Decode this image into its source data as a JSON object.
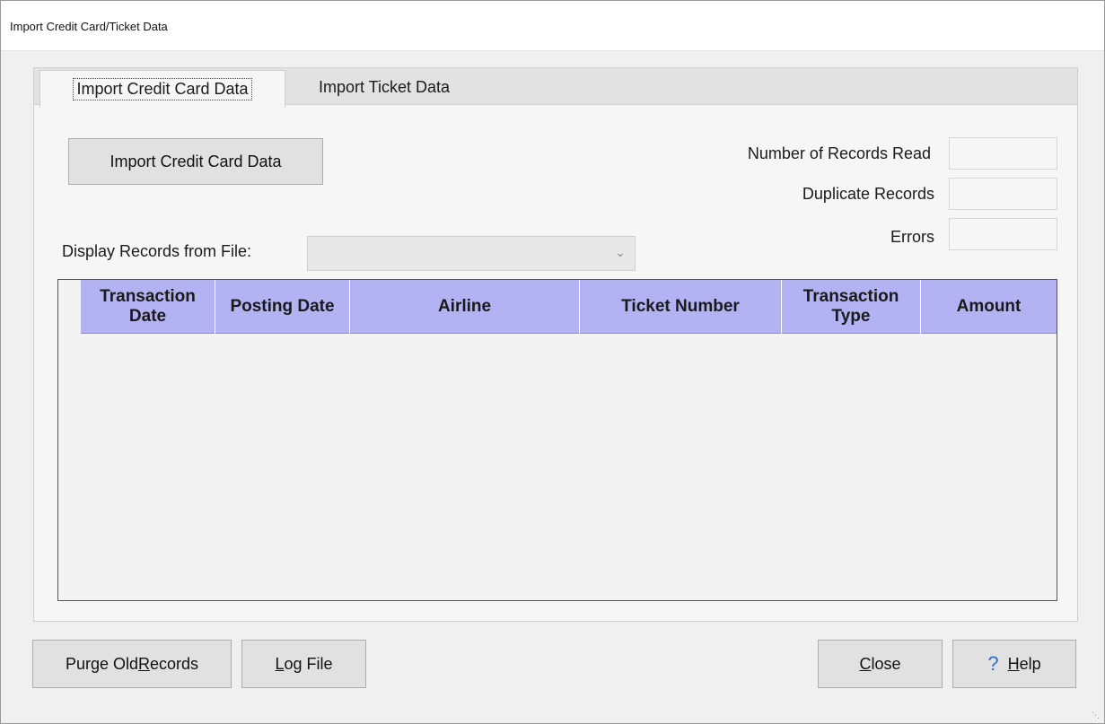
{
  "window": {
    "title": "Import Credit Card/Ticket Data"
  },
  "tabs": [
    {
      "label": "Import Credit Card Data",
      "active": true
    },
    {
      "label": "Import Ticket Data",
      "active": false
    }
  ],
  "panel": {
    "import_button": "Import Credit Card Data",
    "stats": {
      "records_read_label": "Number of Records Read",
      "records_read_value": "",
      "duplicates_label": "Duplicate Records",
      "duplicates_value": "",
      "errors_label": "Errors",
      "errors_value": ""
    },
    "display_label": "Display Records from File:",
    "display_select_value": "",
    "grid": {
      "columns": [
        "Transaction Date",
        "Posting Date",
        "Airline",
        "Ticket Number",
        "Transaction Type",
        "Amount"
      ],
      "rows": []
    }
  },
  "footer": {
    "purge_prefix": "Purge Old ",
    "purge_mnemonic": "R",
    "purge_suffix": "ecords",
    "log_mnemonic": "L",
    "log_suffix": "og File",
    "close_mnemonic": "C",
    "close_suffix": "lose",
    "help_mnemonic": "H",
    "help_suffix": "elp"
  },
  "colors": {
    "grid_header": "#b3b3f3",
    "help_icon": "#2f6fd6"
  },
  "icons": {
    "help": "help-question-icon",
    "dropdown": "chevron-down-icon"
  }
}
